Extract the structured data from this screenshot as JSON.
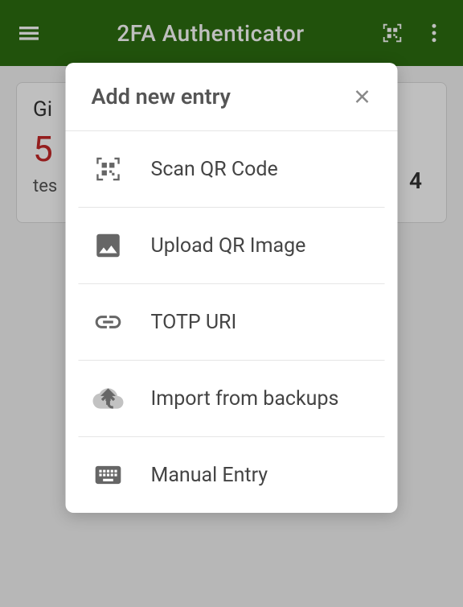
{
  "header": {
    "title": "2FA Authenticator"
  },
  "entries": [
    {
      "issuer": "Gi",
      "code": "5",
      "account": "tes",
      "number": "4"
    }
  ],
  "modal": {
    "title": "Add new entry",
    "items": [
      {
        "label": "Scan QR Code",
        "icon": "qr"
      },
      {
        "label": "Upload QR Image",
        "icon": "image"
      },
      {
        "label": "TOTP URI",
        "icon": "link"
      },
      {
        "label": "Import from backups",
        "icon": "import"
      },
      {
        "label": "Manual Entry",
        "icon": "keyboard"
      }
    ]
  }
}
